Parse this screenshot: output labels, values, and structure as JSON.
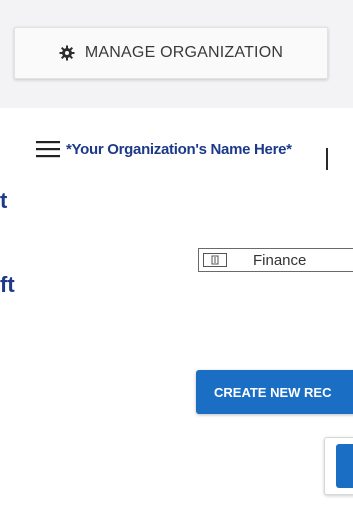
{
  "header": {
    "manage_button": {
      "label": "MANAGE ORGANIZATION",
      "icon": "gear-icon"
    }
  },
  "org_bar": {
    "menu_icon": "hamburger-icon",
    "name": "*Your Organization's Name  Here*"
  },
  "left_fragments": [
    "t",
    "ft"
  ],
  "finance_select": {
    "icon": "grid-icon",
    "value": "Finance"
  },
  "create_button": {
    "label": "CREATE NEW REC"
  },
  "colors": {
    "accent": "#1a6fc4",
    "org_text": "#1d3a8a",
    "top_band": "#f3f3f5"
  }
}
